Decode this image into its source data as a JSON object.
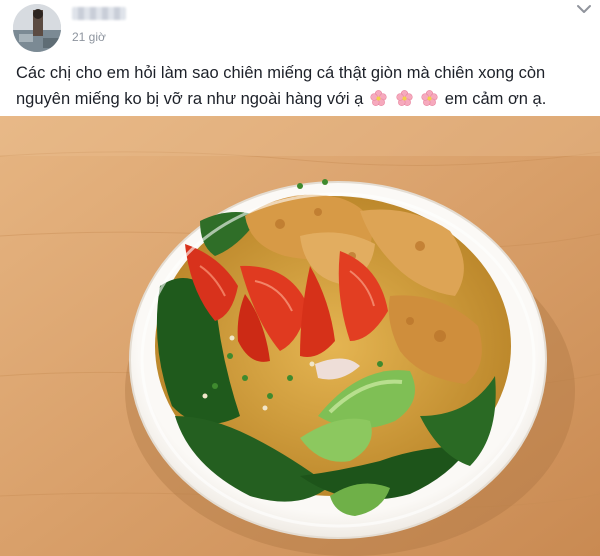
{
  "post": {
    "author": {
      "avatar_icon": "profile-avatar",
      "name_blurred": true
    },
    "timestamp": "21 giờ",
    "more_icon": "chevron-down-icon",
    "caption": {
      "text": "Các chị cho em hỏi làm sao chiên miếng cá thật giòn mà chiên xong còn nguyên miếng ko bị vỡ ra như ngoài hàng với ạ",
      "emoji_icon": "cherry-blossom-icon",
      "emoji_count": 3,
      "trailing_text": "em cảm ơn ạ."
    },
    "photo": {
      "subject": "bowl-of-fish-soup",
      "colors": {
        "table": "#d9a06a",
        "bowl": "#f7f4ef",
        "broth": "#d8a43c",
        "tomato": "#d8321c",
        "greens": "#1f5a1c",
        "fried_fish": "#d79a46"
      }
    }
  }
}
